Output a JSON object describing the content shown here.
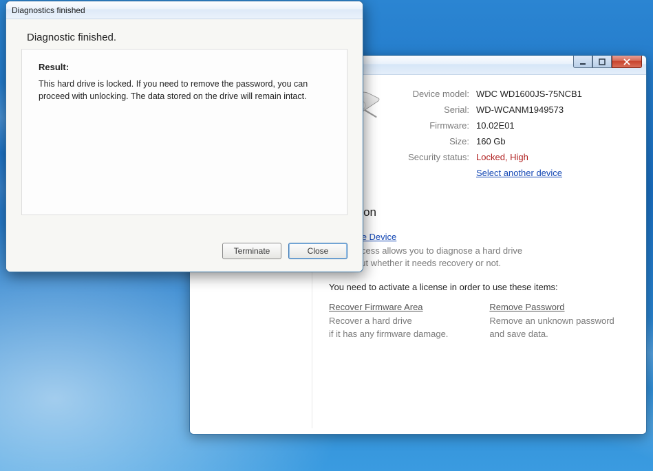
{
  "dialog": {
    "title": "Diagnostics finished",
    "heading": "Diagnostic finished.",
    "result_label": "Result:",
    "result_text": "This hard drive is locked. If you need to remove the password, you can proceed with unlocking. The data stored on the drive will remain intact.",
    "terminate_label": "Terminate",
    "close_label": "Close"
  },
  "main": {
    "device": {
      "labels": {
        "model": "Device model:",
        "serial": "Serial:",
        "firmware": "Firmware:",
        "size": "Size:",
        "security": "Security status:"
      },
      "values": {
        "model": "WDC WD1600JS-75NCB1",
        "serial": "WD-WCANM1949573",
        "firmware": "10.02E01",
        "size": "160 Gb",
        "security": "Locked, High"
      },
      "select_another": "Select another device"
    },
    "actions": {
      "section_title": "an action",
      "diagnose_label": "Diagnose Device",
      "diagnose_desc1": "This process allows you to diagnose a hard drive",
      "diagnose_desc2": "to find out whether it needs recovery or not.",
      "license_note": "You need to activate a license in order to use these items:",
      "recover_label": "Recover Firmware Area",
      "recover_desc1": "Recover a hard drive",
      "recover_desc2": "if it has any firmware damage.",
      "remove_label": "Remove Password",
      "remove_desc1": "Remove an unknown password",
      "remove_desc2": "and save data."
    }
  }
}
